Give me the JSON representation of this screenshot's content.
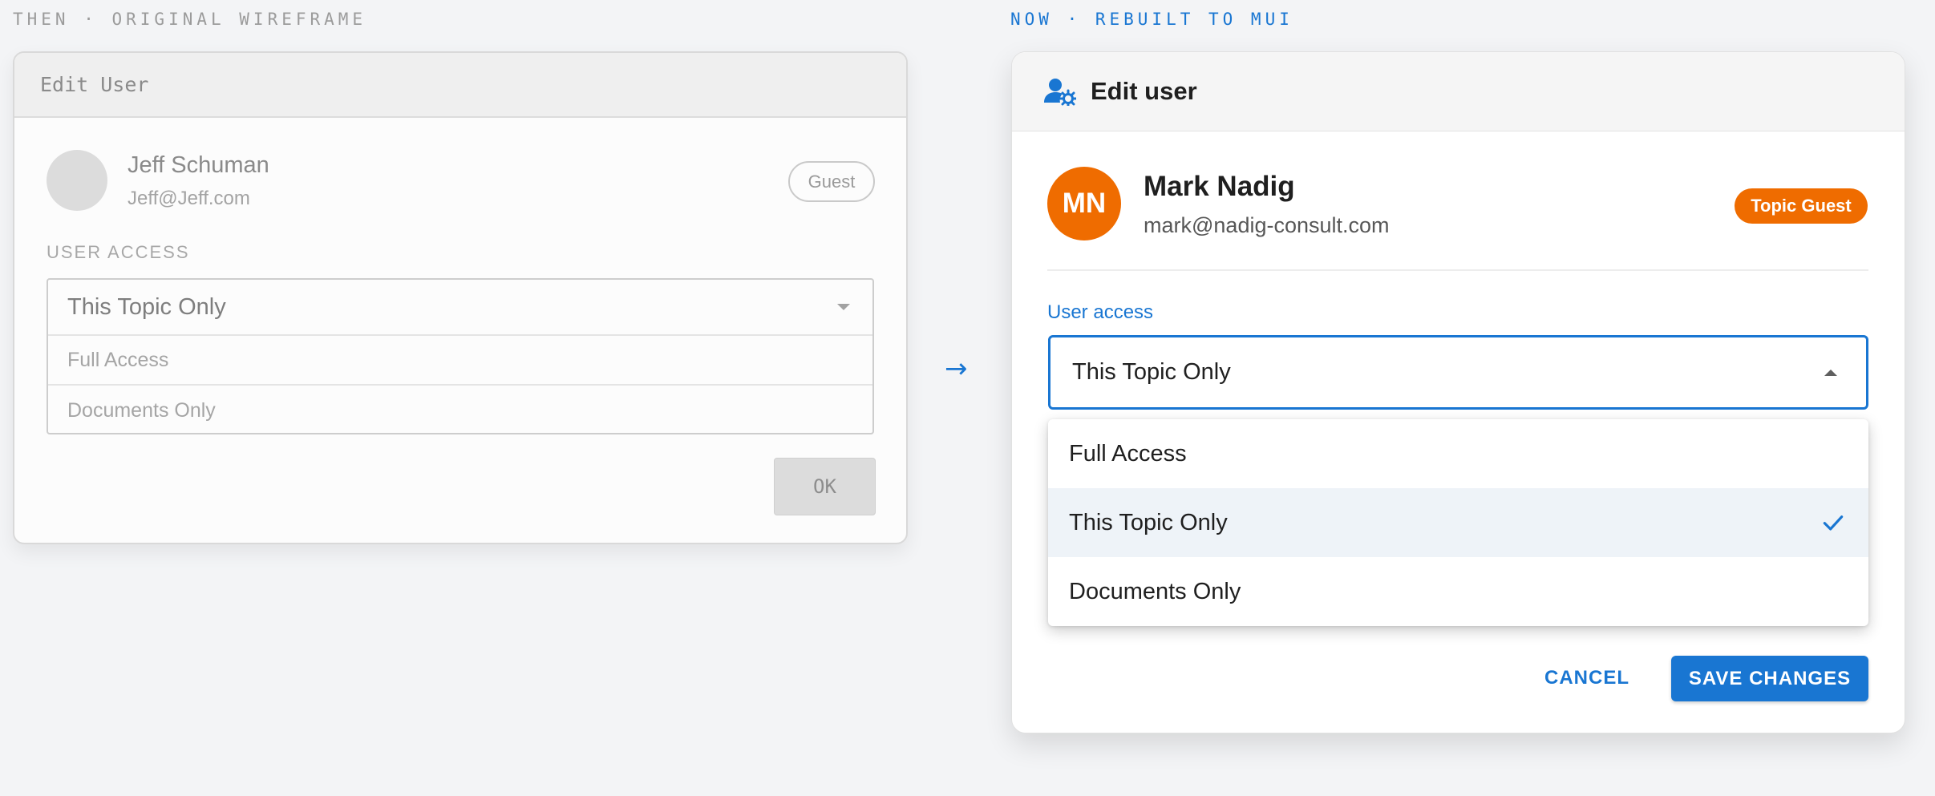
{
  "captions": {
    "then": "THEN · ORIGINAL WIREFRAME",
    "now": "NOW · REBUILT TO MUI"
  },
  "arrow": "→",
  "wireframe": {
    "title": "Edit User",
    "user": {
      "name": "Jeff Schuman",
      "email": "Jeff@Jeff.com",
      "role": "Guest"
    },
    "access_label": "USER ACCESS",
    "select": {
      "value": "This Topic Only",
      "options": [
        "Full Access",
        "Documents Only"
      ]
    },
    "ok_label": "OK"
  },
  "mui": {
    "title": "Edit user",
    "header_icon": "manage-accounts-icon",
    "user": {
      "initials": "MN",
      "name": "Mark Nadig",
      "email": "mark@nadig-consult.com",
      "role": "Topic Guest"
    },
    "access_label": "User access",
    "select": {
      "value": "This Topic Only",
      "options": [
        {
          "label": "Full Access",
          "selected": false
        },
        {
          "label": "This Topic Only",
          "selected": true
        },
        {
          "label": "Documents Only",
          "selected": false
        }
      ]
    },
    "cancel_label": "CANCEL",
    "save_label": "SAVE CHANGES"
  },
  "colors": {
    "primary": "#1976d2",
    "accent": "#ef6c00",
    "background": "#f3f4f6",
    "selected_row": "#eef3f8"
  }
}
